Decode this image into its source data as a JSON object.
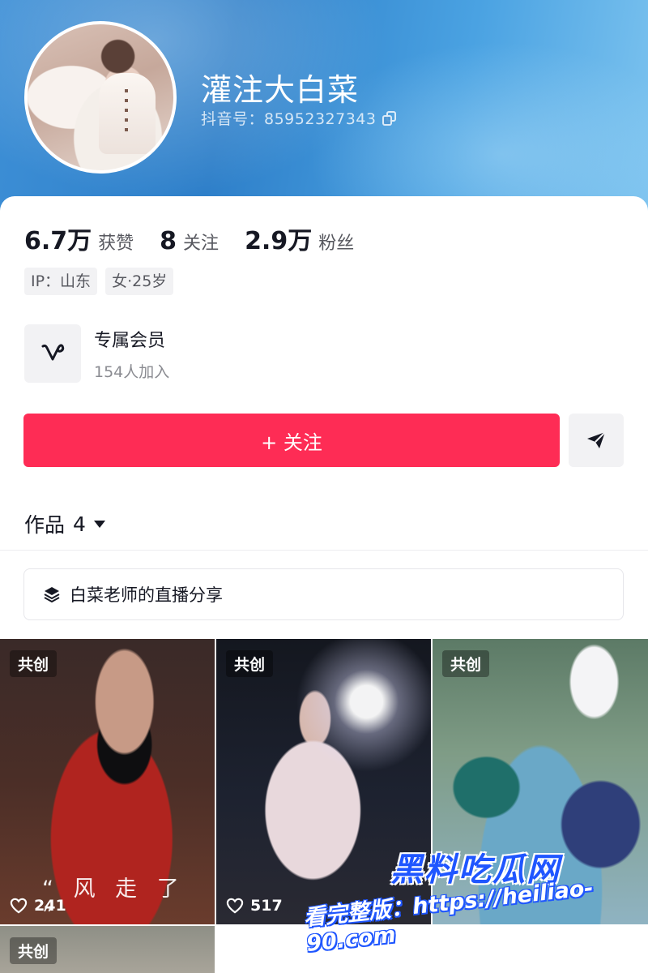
{
  "profile": {
    "username": "灌注大白菜",
    "account_label": "抖音号：85952327343"
  },
  "stats": [
    {
      "value": "6.7万",
      "label": "获赞"
    },
    {
      "value": "8",
      "label": "关注"
    },
    {
      "value": "2.9万",
      "label": "粉丝"
    }
  ],
  "tags": [
    "IP：山东",
    "女·25岁"
  ],
  "membership": {
    "title": "专属会员",
    "subtitle": "154人加入"
  },
  "actions": {
    "follow_label": "+ 关注"
  },
  "works_tab": {
    "label": "作品",
    "count": "4"
  },
  "collection": {
    "label": "白菜老师的直播分享"
  },
  "videos": [
    {
      "badge": "共创",
      "caption": "“ 风 走 了 ”",
      "likes": "241"
    },
    {
      "badge": "共创",
      "likes": "517"
    },
    {
      "badge": "共创"
    },
    {
      "badge": "共创"
    }
  ],
  "watermark": {
    "title": "黑料吃瓜网",
    "url": "看完整版：https://heiliao-90.com"
  },
  "colors": {
    "accent": "#fe2c55",
    "header_blue": "#2e7fc9",
    "watermark_blue": "#1f56ff"
  }
}
